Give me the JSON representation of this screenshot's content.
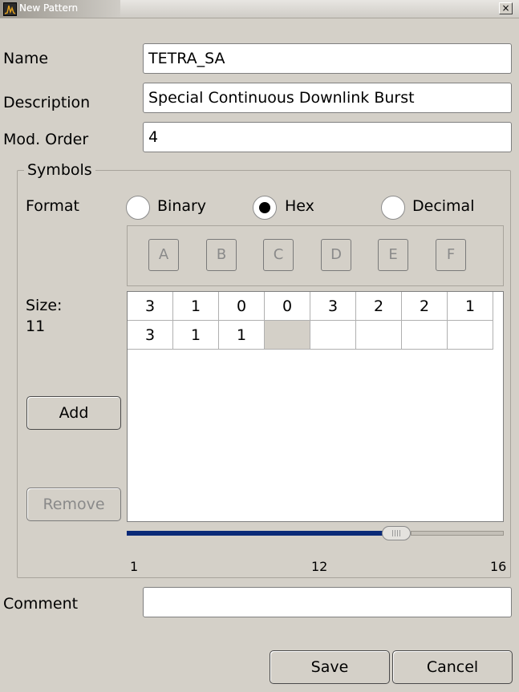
{
  "window": {
    "title": "New Pattern",
    "close_glyph": "×"
  },
  "form": {
    "name_label": "Name",
    "name_value": "TETRA_SA",
    "description_label": "Description",
    "description_value": "Special Continuous Downlink Burst",
    "mod_order_label": "Mod. Order",
    "mod_order_value": "4",
    "comment_label": "Comment",
    "comment_value": ""
  },
  "symbols": {
    "group_title": "Symbols",
    "format_label": "Format",
    "formats": [
      {
        "label": "Binary",
        "selected": false
      },
      {
        "label": "Hex",
        "selected": true
      },
      {
        "label": "Decimal",
        "selected": false
      }
    ],
    "hex_keys": [
      "A",
      "B",
      "C",
      "D",
      "E",
      "F"
    ],
    "size_label": "Size:",
    "size_value": "11",
    "rows": [
      [
        "3",
        "1",
        "0",
        "0",
        "3",
        "2",
        "2",
        "1"
      ],
      [
        "3",
        "1",
        "1",
        "",
        "",
        "",
        "",
        ""
      ]
    ],
    "add_label": "Add",
    "remove_label": "Remove",
    "scroll": {
      "min": "1",
      "value": "12",
      "max": "16",
      "position": 12
    }
  },
  "actions": {
    "save_label": "Save",
    "cancel_label": "Cancel"
  }
}
